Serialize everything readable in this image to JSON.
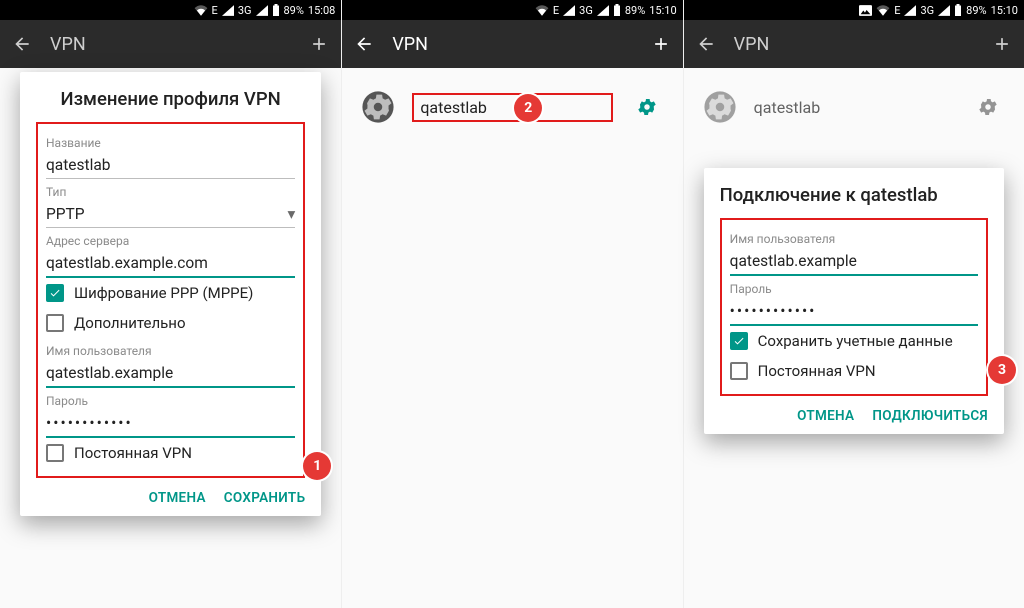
{
  "status": {
    "network_label": "E",
    "network_3g": "3G",
    "battery": "89%",
    "time1": "15:08",
    "time2": "15:10",
    "time3": "15:10"
  },
  "appbar": {
    "title": "VPN"
  },
  "annotations": {
    "b1": "1",
    "b2": "2",
    "b3": "3"
  },
  "screen1": {
    "dialog_title": "Изменение профиля VPN",
    "name_label": "Название",
    "name_value": "qatestlab",
    "type_label": "Тип",
    "type_value": "PPTP",
    "server_label": "Адрес сервера",
    "server_value": "qatestlab.example.com",
    "encrypt_label": "Шифрование PPP (MPPE)",
    "advanced_label": "Дополнительно",
    "user_label": "Имя пользователя",
    "user_value": "qatestlab.example",
    "pass_label": "Пароль",
    "pass_value": "••••••••••••",
    "persistent_label": "Постоянная VPN",
    "cancel": "ОТМЕНА",
    "save": "СОХРАНИТЬ"
  },
  "screen2": {
    "item_name": "qatestlab"
  },
  "screen3": {
    "item_name": "qatestlab",
    "dialog_title": "Подключение к qatestlab",
    "user_label": "Имя пользователя",
    "user_value": "qatestlab.example",
    "pass_label": "Пароль",
    "pass_value": "••••••••••••",
    "save_creds_label": "Сохранить учетные данные",
    "persistent_label": "Постоянная VPN",
    "cancel": "ОТМЕНА",
    "connect": "ПОДКЛЮЧИТЬСЯ"
  }
}
